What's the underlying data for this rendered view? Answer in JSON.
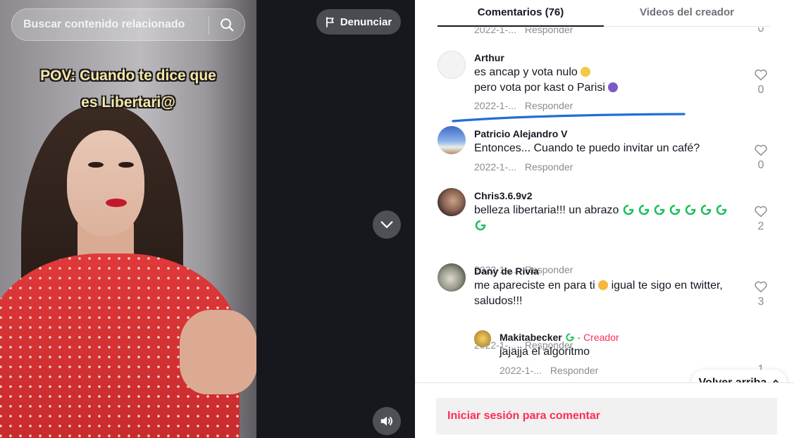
{
  "search": {
    "placeholder": "Buscar contenido relacionado"
  },
  "video": {
    "caption_line1": "POV: Cuando te dice que",
    "caption_line2": "es Libertari@",
    "report_label": "Denunciar"
  },
  "tabs": [
    {
      "label": "Comentarios (76)",
      "active": true
    },
    {
      "label": "Videos del creador",
      "active": false
    }
  ],
  "comments": [
    {
      "meta_date": "2022-1-...",
      "reply_label": "Responder",
      "likes": "0"
    },
    {
      "username": "Arthur",
      "text_line1": "es ancap y vota nulo",
      "text_line2": "pero vota por kast o Parisi",
      "meta_date": "2022-1-...",
      "reply_label": "Responder",
      "likes": "0"
    },
    {
      "username": "Patricio Alejandro V",
      "text": "Entonces... Cuando te puedo invitar un café?",
      "meta_date": "2022-1-...",
      "reply_label": "Responder",
      "likes": "0"
    },
    {
      "username": "Chris3.6.9v2",
      "text": "belleza libertaria!!! un abrazo",
      "meta_date": "2022-1-...",
      "reply_label": "Responder",
      "likes": "2"
    },
    {
      "username": "Dany de Rivia",
      "text_line1": "me apareciste en para ti",
      "text_line1b": "igual te sigo en twitter,",
      "text_line2": "saludos!!!",
      "meta_date": "2022-1-...",
      "reply_label": "Responder",
      "likes": "3"
    },
    {
      "username": "Makitabecker",
      "creator_badge": "Creador",
      "separator": "·",
      "text": "jajajja el algoritmo",
      "meta_date": "2022-1-...",
      "reply_label": "Responder",
      "likes": "1"
    }
  ],
  "scroll_top_label": "Volver arriba",
  "login_prompt": "Iniciar sesión para comentar",
  "colors": {
    "accent": "#fe2c55",
    "text_primary": "#161823",
    "text_secondary": "#8a8b91",
    "annotation_blue": "#1f6fd6"
  },
  "icons": [
    "search-icon",
    "flag-icon",
    "chevron-down-icon",
    "volume-icon",
    "heart-icon",
    "double-chevron-up-icon"
  ]
}
